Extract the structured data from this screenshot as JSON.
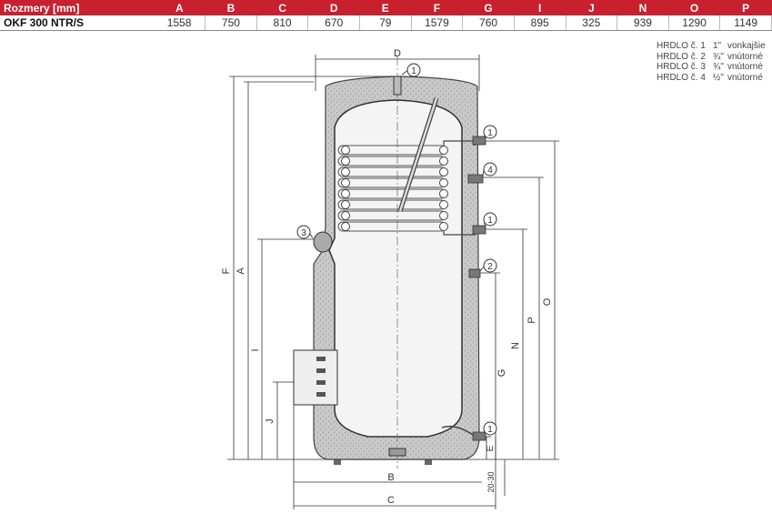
{
  "table": {
    "header_label": "Rozmery [mm]",
    "columns": [
      "A",
      "B",
      "C",
      "D",
      "E",
      "F",
      "G",
      "I",
      "J",
      "N",
      "O",
      "P"
    ],
    "model": "OKF 300 NTR/S",
    "values": [
      "1558",
      "750",
      "810",
      "670",
      "79",
      "1579",
      "760",
      "895",
      "325",
      "939",
      "1290",
      "1149"
    ]
  },
  "legend": [
    {
      "name": "HRDLO č. 1",
      "size": "1\"",
      "desc": "vonkajšie"
    },
    {
      "name": "HRDLO č. 2",
      "size": "¾\"",
      "desc": "vnútorné"
    },
    {
      "name": "HRDLO č. 3",
      "size": "¾\"",
      "desc": "vnútorné"
    },
    {
      "name": "HRDLO č. 4",
      "size": "½\"",
      "desc": "vnútorné"
    }
  ],
  "diagram": {
    "dimension_labels": {
      "D": "D",
      "F": "F",
      "A": "A",
      "I": "I",
      "J": "J",
      "B": "B",
      "C": "C",
      "E": "E",
      "G": "G",
      "N": "N",
      "P": "P",
      "O": "O",
      "gap": "20-30"
    },
    "callouts": [
      "1",
      "1",
      "4",
      "1",
      "3",
      "2",
      "1"
    ]
  }
}
